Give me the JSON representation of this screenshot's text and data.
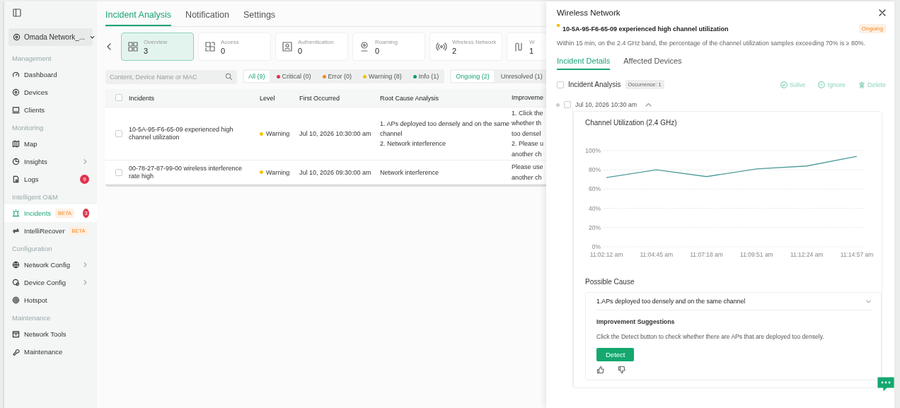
{
  "sidebar": {
    "site": "Omada Network_...",
    "groups": [
      {
        "title": "Management",
        "items": [
          {
            "label": "Dashboard",
            "selected": false,
            "expandable": false
          },
          {
            "label": "Devices",
            "selected": false,
            "expandable": false
          },
          {
            "label": "Clients",
            "selected": false,
            "expandable": false
          }
        ]
      },
      {
        "title": "Monitoring",
        "items": [
          {
            "label": "Map",
            "selected": false,
            "expandable": false
          },
          {
            "label": "Insights",
            "selected": false,
            "expandable": true
          },
          {
            "label": "Logs",
            "selected": false,
            "expandable": false,
            "badge": "9"
          }
        ]
      },
      {
        "title": "Intelligent O&M",
        "items": [
          {
            "label": "Incidents",
            "selected": true,
            "expandable": false,
            "tag": "BETA",
            "badge": "3"
          },
          {
            "label": "IntelliRecover",
            "selected": false,
            "expandable": false,
            "tag": "BETA"
          }
        ]
      },
      {
        "title": "Configuration",
        "items": [
          {
            "label": "Network Config",
            "selected": false,
            "expandable": true
          },
          {
            "label": "Device Config",
            "selected": false,
            "expandable": true
          },
          {
            "label": "Hotspot",
            "selected": false,
            "expandable": false
          }
        ]
      },
      {
        "title": "Maintenance",
        "items": [
          {
            "label": "Network Tools",
            "selected": false,
            "expandable": false
          },
          {
            "label": "Maintenance",
            "selected": false,
            "expandable": false
          }
        ]
      }
    ]
  },
  "tabs": [
    {
      "label": "Incident Analysis",
      "selected": true
    },
    {
      "label": "Notification",
      "selected": false
    },
    {
      "label": "Settings",
      "selected": false
    }
  ],
  "categories": [
    {
      "label": "Overview",
      "count": "3",
      "selected": true
    },
    {
      "label": "Access",
      "count": "0",
      "selected": false
    },
    {
      "label": "Authentication",
      "count": "0",
      "selected": false
    },
    {
      "label": "Roaming",
      "count": "0",
      "selected": false
    },
    {
      "label": "Wireless Network",
      "count": "2",
      "selected": false
    },
    {
      "label": "W",
      "count": "1",
      "selected": false
    }
  ],
  "search": {
    "placeholder": "Content, Device Name or MAC"
  },
  "level_filters": [
    {
      "label": "All (9)",
      "selected": true
    },
    {
      "label": "Critical (0)",
      "color": "#e0324f",
      "selected": false
    },
    {
      "label": "Error (0)",
      "color": "#f08a24",
      "selected": false
    },
    {
      "label": "Warning (8)",
      "color": "#f5c400",
      "selected": false
    },
    {
      "label": "Info (1)",
      "color": "#0f9d6b",
      "selected": false
    }
  ],
  "status_filters": [
    {
      "label": "Ongoing (2)",
      "selected": true
    },
    {
      "label": "Unresolved (1)",
      "selected": false
    }
  ],
  "table": {
    "all_checked": false,
    "columns": [
      "Incidents",
      "Level",
      "First Occurred",
      "Root Cause Analysis",
      "Improveme"
    ],
    "rows": [
      {
        "checked": false,
        "incident": "10-5A-95-F6-65-09 experienced high channel utilization",
        "level": "Warning",
        "color": "#f5c400",
        "first_occurred": "Jul 10, 2026 10:30:00 am",
        "root_cause": [
          "1. APs deployed too densely and on the same channel",
          "2. Network interference"
        ],
        "improvement": [
          "1. Click the",
          "whether th",
          "too densel",
          "2. Please u",
          "another ch"
        ]
      },
      {
        "checked": false,
        "incident": "00-78-27-87-99-00 wireless interference rate high",
        "level": "Warning",
        "color": "#f5c400",
        "first_occurred": "Jul 10, 2026 09:30:00 am",
        "root_cause": [
          "Network interference"
        ],
        "improvement": [
          "Please use",
          "another ch"
        ]
      }
    ]
  },
  "drawer": {
    "title": "Wireless Network",
    "incident": {
      "title": "10-5A-95-F6-65-09 experienced high channel utilization",
      "color": "#f5c400",
      "status": "Ongoing",
      "description": "Within 15 min, on the 2.4 GHz band, the percentage of the channel utilization samples exceeding 70% is ≥ 80%."
    },
    "tabs": [
      {
        "label": "Incident Details",
        "selected": true
      },
      {
        "label": "Affected Devices",
        "selected": false
      }
    ],
    "analysis": {
      "label": "Incident Analysis",
      "checked": false,
      "occurrence": "Occurrence: 1",
      "actions": [
        "Solve",
        "Ignore",
        "Delete"
      ]
    },
    "entry": {
      "time": "Jul 10, 2026 10:30 am",
      "checked": false,
      "expanded": true,
      "chart_title": "Channel Utilization (2.4 GHz)",
      "chart_data": {
        "type": "line",
        "categories": [
          "11:02:12 am",
          "11:04:45 am",
          "11:07:18 am",
          "11:09:51 am",
          "11:12:24 am",
          "11:14:57 am"
        ],
        "series": [
          {
            "color": "#4f9d9a",
            "values": [
              72,
              80,
              73,
              81,
              84,
              94
            ]
          }
        ],
        "grid": true,
        "ylim": [
          0,
          100
        ],
        "yticks": [
          {
            "value": 0,
            "label": "0%"
          },
          {
            "value": 20,
            "label": "20%"
          },
          {
            "value": 40,
            "label": "40%"
          },
          {
            "value": 60,
            "label": "60%"
          },
          {
            "value": 80,
            "label": "80%"
          },
          {
            "value": 100,
            "label": "100%"
          }
        ]
      },
      "cause_heading": "Possible Cause",
      "causes": [
        {
          "title": "1.APs deployed too densely and on the same channel",
          "expanded": true,
          "suggest_title": "Improvement Suggestions",
          "suggestion": "Click the Detect button to check whether there are APs that are deployed too densely.",
          "button": "Detect"
        }
      ]
    }
  }
}
